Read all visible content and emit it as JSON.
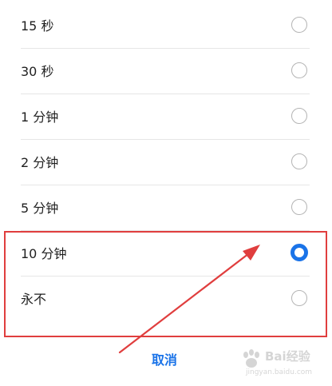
{
  "options": [
    {
      "label": "15 秒",
      "selected": false
    },
    {
      "label": "30 秒",
      "selected": false
    },
    {
      "label": "1 分钟",
      "selected": false
    },
    {
      "label": "2 分钟",
      "selected": false
    },
    {
      "label": "5 分钟",
      "selected": false
    },
    {
      "label": "10 分钟",
      "selected": true
    },
    {
      "label": "永不",
      "selected": false
    }
  ],
  "cancel_label": "取消",
  "colors": {
    "accent": "#1a73e8",
    "annotation": "#e03e3e",
    "divider": "#e6e6e6"
  },
  "icons": {
    "arrow": "arrow-icon",
    "watermark_logo": "baidu-paw-icon"
  },
  "watermark": {
    "text": "Bai经验",
    "url": "jingyan.baidu.com"
  }
}
